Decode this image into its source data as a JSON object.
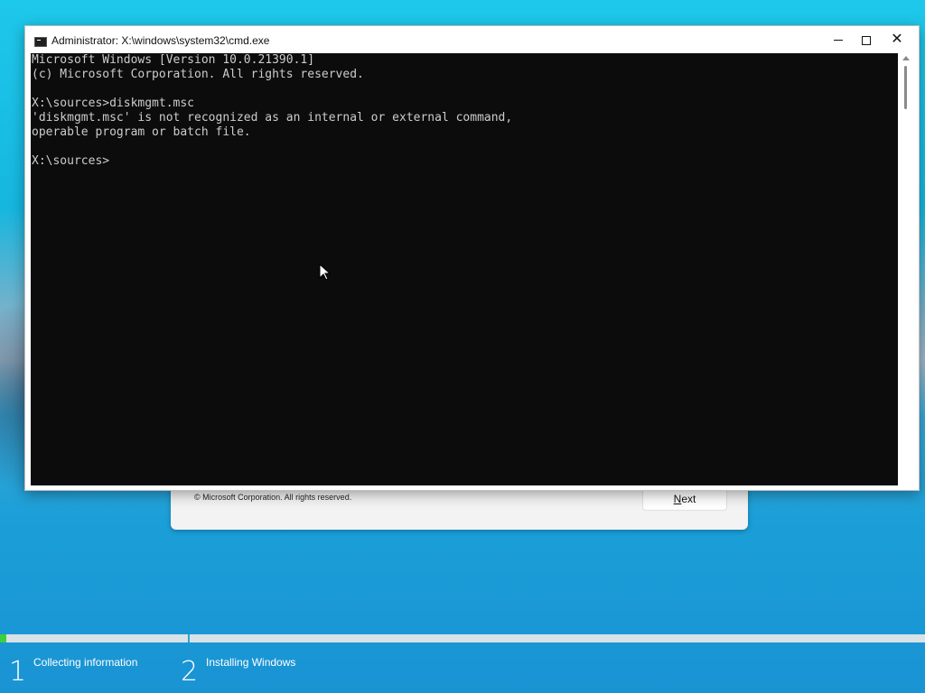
{
  "cmd_window": {
    "title": "Administrator: X:\\windows\\system32\\cmd.exe",
    "console_lines": [
      "Microsoft Windows [Version 10.0.21390.1]",
      "(c) Microsoft Corporation. All rights reserved.",
      "",
      "X:\\sources>diskmgmt.msc",
      "'diskmgmt.msc' is not recognized as an internal or external command,",
      "operable program or batch file.",
      "",
      "X:\\sources>"
    ],
    "buttons": {
      "minimize_icon": "minimize-icon",
      "maximize_icon": "maximize-icon",
      "close_icon": "close-icon"
    }
  },
  "setup_dialog": {
    "copyright": "© Microsoft Corporation. All rights reserved.",
    "next_label_first": "N",
    "next_label_rest": "ext"
  },
  "setup_progress": {
    "progress_fraction": 0.007,
    "steps": [
      {
        "number": "1",
        "label": "Collecting information"
      },
      {
        "number": "2",
        "label": "Installing Windows"
      }
    ]
  },
  "colors": {
    "console_bg": "#0c0c0c",
    "console_fg": "#cccccc",
    "progress_fill": "#3ecf3e"
  }
}
